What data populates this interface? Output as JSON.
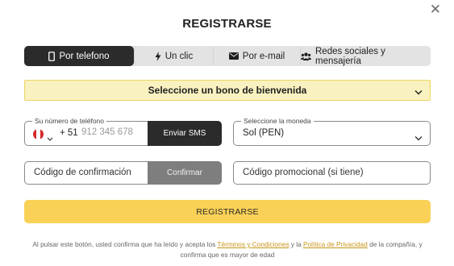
{
  "modal": {
    "title": "REGISTRARSE",
    "close_icon": "close-icon"
  },
  "tabs": [
    {
      "label": "Por telefono",
      "icon": "phone-icon",
      "active": true
    },
    {
      "label": "Un clic",
      "icon": "lightning-icon",
      "active": false
    },
    {
      "label": "Por e-mail",
      "icon": "envelope-icon",
      "active": false
    },
    {
      "label": "Redes sociales y mensajería",
      "icon": "users-icon",
      "active": false
    }
  ],
  "bonus": {
    "label": "Seleccione un bono de bienvenida"
  },
  "phone": {
    "legend": "Su número de teléfono",
    "country_code": "+ 51",
    "placeholder": "912 345 678",
    "value": "",
    "send_button": "Enviar SMS"
  },
  "currency": {
    "legend": "Seleccione la moneda",
    "selected": "Sol (PEN)"
  },
  "confirmation": {
    "placeholder": "Código de confirmación",
    "button": "Confirmar"
  },
  "promo": {
    "placeholder": "Código promocional (si tiene)"
  },
  "register_button": "REGISTRARSE",
  "legal": {
    "text_before": "Al pulsar este botón, usted confirma que ha leído y acepta los ",
    "terms_link": "Términos y Condiciones",
    "text_middle": " y la ",
    "privacy_link": "Política de Privacidad",
    "text_after": " de la compañía, y confirma que es mayor de edad"
  },
  "colors": {
    "active_tab": "#2b2b2b",
    "tab_bar": "#e3e3e3",
    "bonus_bg": "#f9f1bf",
    "bonus_border": "#ecd664",
    "register_bg": "#fad157",
    "link": "#c8951a",
    "confirm_btn": "#7e7e7e"
  }
}
